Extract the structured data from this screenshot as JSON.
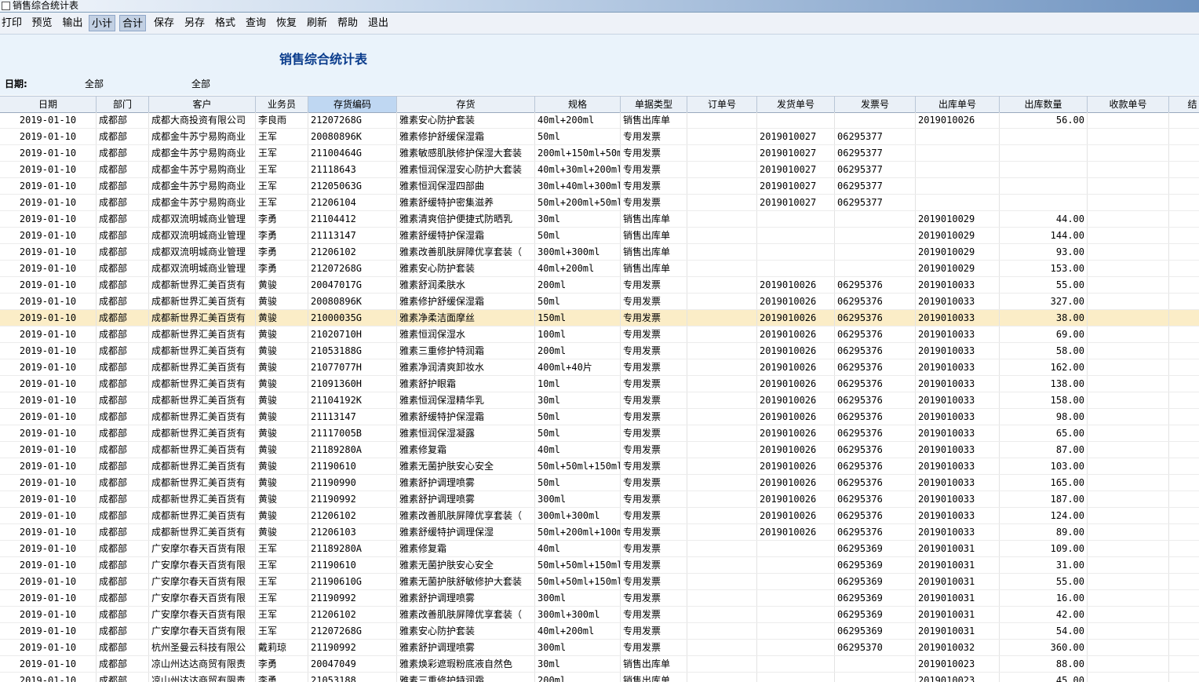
{
  "window": {
    "title": "销售综合统计表"
  },
  "toolbar": [
    {
      "label": "打印",
      "active": false
    },
    {
      "label": "预览",
      "active": false
    },
    {
      "label": "输出",
      "active": false
    },
    {
      "label": "小计",
      "active": true
    },
    {
      "label": "合计",
      "active": true
    },
    {
      "label": "保存",
      "active": false
    },
    {
      "label": "另存",
      "active": false
    },
    {
      "label": "格式",
      "active": false
    },
    {
      "label": "查询",
      "active": false
    },
    {
      "label": "恢复",
      "active": false
    },
    {
      "label": "刷新",
      "active": false
    },
    {
      "label": "帮助",
      "active": false
    },
    {
      "label": "退出",
      "active": false
    }
  ],
  "report": {
    "title": "销售综合统计表",
    "date_label": "日期:",
    "date_from": "全部",
    "date_to": "全部"
  },
  "columns": [
    "日期",
    "部门",
    "客户",
    "业务员",
    "存货编码",
    "存货",
    "规格",
    "单据类型",
    "订单号",
    "发货单号",
    "发票号",
    "出库单号",
    "出库数量",
    "收款单号",
    "结"
  ],
  "highlight_row": 12,
  "rows": [
    [
      "2019-01-10",
      "成都部",
      "成都大商投资有限公司",
      "李良雨",
      "21207268G",
      "雅素安心防护套装",
      "40ml+200ml",
      "销售出库单",
      "",
      "",
      "",
      "2019010026",
      "56.00",
      ""
    ],
    [
      "2019-01-10",
      "成都部",
      "成都金牛苏宁易购商业",
      "王军",
      "20080896K",
      "雅素修护舒缓保湿霜",
      "50ml",
      "专用发票",
      "",
      "2019010027",
      "06295377",
      "",
      "",
      ""
    ],
    [
      "2019-01-10",
      "成都部",
      "成都金牛苏宁易购商业",
      "王军",
      "21100464G",
      "雅素敏感肌肤修护保湿大套装",
      "200ml+150ml+50ml",
      "专用发票",
      "",
      "2019010027",
      "06295377",
      "",
      "",
      ""
    ],
    [
      "2019-01-10",
      "成都部",
      "成都金牛苏宁易购商业",
      "王军",
      "21118643",
      "雅素恒润保湿安心防护大套装",
      "40ml+30ml+200ml",
      "专用发票",
      "",
      "2019010027",
      "06295377",
      "",
      "",
      ""
    ],
    [
      "2019-01-10",
      "成都部",
      "成都金牛苏宁易购商业",
      "王军",
      "21205063G",
      "雅素恒润保湿四部曲",
      "30ml+40ml+300ml",
      "专用发票",
      "",
      "2019010027",
      "06295377",
      "",
      "",
      ""
    ],
    [
      "2019-01-10",
      "成都部",
      "成都金牛苏宁易购商业",
      "王军",
      "21206104",
      "雅素舒缓特护密集滋养",
      "50ml+200ml+50ml",
      "专用发票",
      "",
      "2019010027",
      "06295377",
      "",
      "",
      ""
    ],
    [
      "2019-01-10",
      "成都部",
      "成都双流明城商业管理",
      "李勇",
      "21104412",
      "雅素清爽倍护便捷式防晒乳",
      "30ml",
      "销售出库单",
      "",
      "",
      "",
      "2019010029",
      "44.00",
      ""
    ],
    [
      "2019-01-10",
      "成都部",
      "成都双流明城商业管理",
      "李勇",
      "21113147",
      "雅素舒缓特护保湿霜",
      "50ml",
      "销售出库单",
      "",
      "",
      "",
      "2019010029",
      "144.00",
      ""
    ],
    [
      "2019-01-10",
      "成都部",
      "成都双流明城商业管理",
      "李勇",
      "21206102",
      "雅素改善肌肤屏障优享套装（",
      "300ml+300ml",
      "销售出库单",
      "",
      "",
      "",
      "2019010029",
      "93.00",
      ""
    ],
    [
      "2019-01-10",
      "成都部",
      "成都双流明城商业管理",
      "李勇",
      "21207268G",
      "雅素安心防护套装",
      "40ml+200ml",
      "销售出库单",
      "",
      "",
      "",
      "2019010029",
      "153.00",
      ""
    ],
    [
      "2019-01-10",
      "成都部",
      "成都新世界汇美百货有",
      "黄骏",
      "20047017G",
      "雅素舒润柔肤水",
      "200ml",
      "专用发票",
      "",
      "2019010026",
      "06295376",
      "2019010033",
      "55.00",
      ""
    ],
    [
      "2019-01-10",
      "成都部",
      "成都新世界汇美百货有",
      "黄骏",
      "20080896K",
      "雅素修护舒缓保湿霜",
      "50ml",
      "专用发票",
      "",
      "2019010026",
      "06295376",
      "2019010033",
      "327.00",
      ""
    ],
    [
      "2019-01-10",
      "成都部",
      "成都新世界汇美百货有",
      "黄骏",
      "21000035G",
      "雅素净柔洁面摩丝",
      "150ml",
      "专用发票",
      "",
      "2019010026",
      "06295376",
      "2019010033",
      "38.00",
      ""
    ],
    [
      "2019-01-10",
      "成都部",
      "成都新世界汇美百货有",
      "黄骏",
      "21020710H",
      "雅素恒润保湿水",
      "100ml",
      "专用发票",
      "",
      "2019010026",
      "06295376",
      "2019010033",
      "69.00",
      ""
    ],
    [
      "2019-01-10",
      "成都部",
      "成都新世界汇美百货有",
      "黄骏",
      "21053188G",
      "雅素三重修护特润霜",
      "200ml",
      "专用发票",
      "",
      "2019010026",
      "06295376",
      "2019010033",
      "58.00",
      ""
    ],
    [
      "2019-01-10",
      "成都部",
      "成都新世界汇美百货有",
      "黄骏",
      "21077077H",
      "雅素净润清爽卸妆水",
      "400ml+40片",
      "专用发票",
      "",
      "2019010026",
      "06295376",
      "2019010033",
      "162.00",
      ""
    ],
    [
      "2019-01-10",
      "成都部",
      "成都新世界汇美百货有",
      "黄骏",
      "21091360H",
      "雅素舒护眼霜",
      "10ml",
      "专用发票",
      "",
      "2019010026",
      "06295376",
      "2019010033",
      "138.00",
      ""
    ],
    [
      "2019-01-10",
      "成都部",
      "成都新世界汇美百货有",
      "黄骏",
      "21104192K",
      "雅素恒润保湿精华乳",
      "30ml",
      "专用发票",
      "",
      "2019010026",
      "06295376",
      "2019010033",
      "158.00",
      ""
    ],
    [
      "2019-01-10",
      "成都部",
      "成都新世界汇美百货有",
      "黄骏",
      "21113147",
      "雅素舒缓特护保湿霜",
      "50ml",
      "专用发票",
      "",
      "2019010026",
      "06295376",
      "2019010033",
      "98.00",
      ""
    ],
    [
      "2019-01-10",
      "成都部",
      "成都新世界汇美百货有",
      "黄骏",
      "21117005B",
      "雅素恒润保湿凝露",
      "50ml",
      "专用发票",
      "",
      "2019010026",
      "06295376",
      "2019010033",
      "65.00",
      ""
    ],
    [
      "2019-01-10",
      "成都部",
      "成都新世界汇美百货有",
      "黄骏",
      "21189280A",
      "雅素修复霜",
      "40ml",
      "专用发票",
      "",
      "2019010026",
      "06295376",
      "2019010033",
      "87.00",
      ""
    ],
    [
      "2019-01-10",
      "成都部",
      "成都新世界汇美百货有",
      "黄骏",
      "21190610",
      "雅素无菌护肤安心安全",
      "50ml+50ml+150ml",
      "专用发票",
      "",
      "2019010026",
      "06295376",
      "2019010033",
      "103.00",
      ""
    ],
    [
      "2019-01-10",
      "成都部",
      "成都新世界汇美百货有",
      "黄骏",
      "21190990",
      "雅素舒护调理喷雾",
      "50ml",
      "专用发票",
      "",
      "2019010026",
      "06295376",
      "2019010033",
      "165.00",
      ""
    ],
    [
      "2019-01-10",
      "成都部",
      "成都新世界汇美百货有",
      "黄骏",
      "21190992",
      "雅素舒护调理喷雾",
      "300ml",
      "专用发票",
      "",
      "2019010026",
      "06295376",
      "2019010033",
      "187.00",
      ""
    ],
    [
      "2019-01-10",
      "成都部",
      "成都新世界汇美百货有",
      "黄骏",
      "21206102",
      "雅素改善肌肤屏障优享套装（",
      "300ml+300ml",
      "专用发票",
      "",
      "2019010026",
      "06295376",
      "2019010033",
      "124.00",
      ""
    ],
    [
      "2019-01-10",
      "成都部",
      "成都新世界汇美百货有",
      "黄骏",
      "21206103",
      "雅素舒缓特护调理保湿",
      "50ml+200ml+100ml",
      "专用发票",
      "",
      "2019010026",
      "06295376",
      "2019010033",
      "89.00",
      ""
    ],
    [
      "2019-01-10",
      "成都部",
      "广安摩尔春天百货有限",
      "王军",
      "21189280A",
      "雅素修复霜",
      "40ml",
      "专用发票",
      "",
      "",
      "06295369",
      "2019010031",
      "109.00",
      ""
    ],
    [
      "2019-01-10",
      "成都部",
      "广安摩尔春天百货有限",
      "王军",
      "21190610",
      "雅素无菌护肤安心安全",
      "50ml+50ml+150ml",
      "专用发票",
      "",
      "",
      "06295369",
      "2019010031",
      "31.00",
      ""
    ],
    [
      "2019-01-10",
      "成都部",
      "广安摩尔春天百货有限",
      "王军",
      "21190610G",
      "雅素无菌护肤舒敏修护大套装",
      "50ml+50ml+150ml",
      "专用发票",
      "",
      "",
      "06295369",
      "2019010031",
      "55.00",
      ""
    ],
    [
      "2019-01-10",
      "成都部",
      "广安摩尔春天百货有限",
      "王军",
      "21190992",
      "雅素舒护调理喷雾",
      "300ml",
      "专用发票",
      "",
      "",
      "06295369",
      "2019010031",
      "16.00",
      ""
    ],
    [
      "2019-01-10",
      "成都部",
      "广安摩尔春天百货有限",
      "王军",
      "21206102",
      "雅素改善肌肤屏障优享套装（",
      "300ml+300ml",
      "专用发票",
      "",
      "",
      "06295369",
      "2019010031",
      "42.00",
      ""
    ],
    [
      "2019-01-10",
      "成都部",
      "广安摩尔春天百货有限",
      "王军",
      "21207268G",
      "雅素安心防护套装",
      "40ml+200ml",
      "专用发票",
      "",
      "",
      "06295369",
      "2019010031",
      "54.00",
      ""
    ],
    [
      "2019-01-10",
      "成都部",
      "杭州圣曼云科技有限公",
      "戴莉琼",
      "21190992",
      "雅素舒护调理喷雾",
      "300ml",
      "专用发票",
      "",
      "",
      "06295370",
      "2019010032",
      "360.00",
      ""
    ],
    [
      "2019-01-10",
      "成都部",
      "凉山州达达商贸有限责",
      "李勇",
      "20047049",
      "雅素焕彩遮瑕粉底液自然色",
      "30ml",
      "销售出库单",
      "",
      "",
      "",
      "2019010023",
      "88.00",
      ""
    ],
    [
      "2019-01-10",
      "成都部",
      "凉山州达达商贸有限责",
      "李勇",
      "21053188",
      "雅素三重修护特润霜",
      "200ml",
      "销售出库单",
      "",
      "",
      "",
      "2019010023",
      "45.00",
      ""
    ]
  ]
}
